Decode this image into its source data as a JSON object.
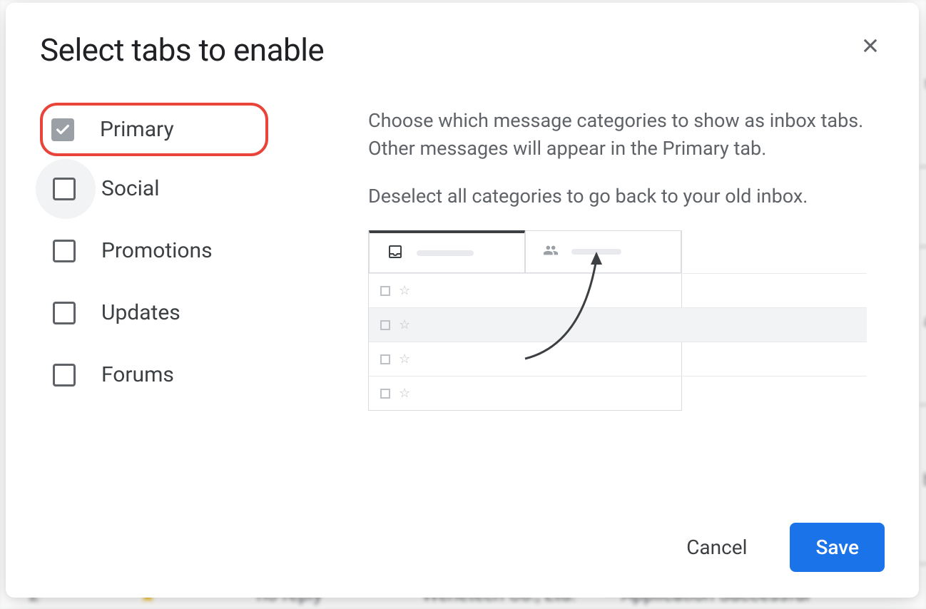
{
  "dialog": {
    "title": "Select tabs to enable",
    "description_line1": "Choose which message categories to show as inbox tabs. Other messages will appear in the Primary tab.",
    "description_line2": "Deselect all categories to go back to your old inbox.",
    "options": [
      {
        "label": "Primary",
        "checked": true,
        "disabled": true,
        "highlighted": true
      },
      {
        "label": "Social",
        "checked": false,
        "hovered": true
      },
      {
        "label": "Promotions",
        "checked": false
      },
      {
        "label": "Updates",
        "checked": false
      },
      {
        "label": "Forums",
        "checked": false
      }
    ],
    "buttons": {
      "cancel": "Cancel",
      "save": "Save"
    }
  },
  "background": {
    "sender": "no-reply",
    "company": "Wenetech Co., Ltd.",
    "subject": "Application Successful"
  }
}
